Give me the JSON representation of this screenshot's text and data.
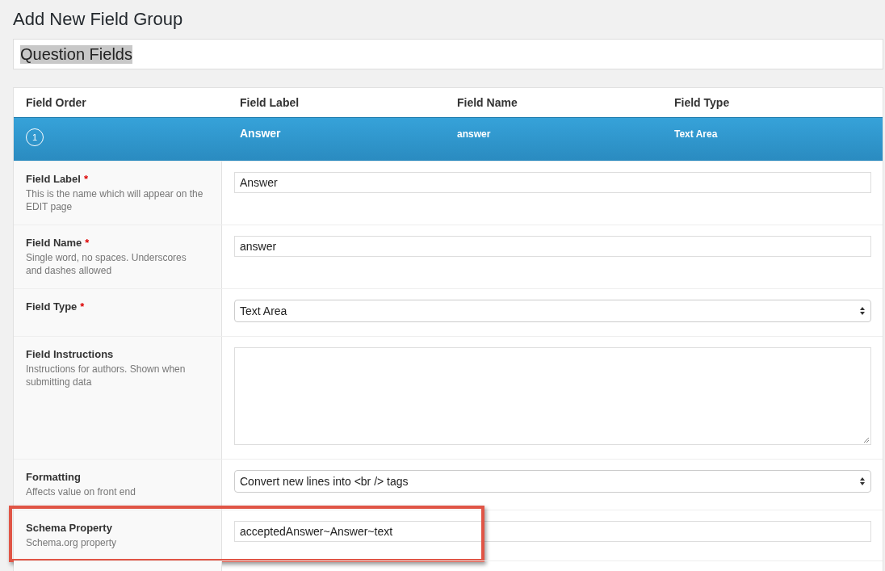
{
  "page_title": "Add New Field Group",
  "title_field": {
    "value": "Question Fields",
    "text_selected": true
  },
  "table": {
    "columns": [
      "Field Order",
      "Field Label",
      "Field Name",
      "Field Type"
    ],
    "rows": [
      {
        "order": "1",
        "label": "Answer",
        "name": "answer",
        "type": "Text Area",
        "selected": true
      }
    ]
  },
  "settings": [
    {
      "label": "Field Label",
      "required_mark": "*",
      "description": "This is the name which will appear on the EDIT page",
      "kind": "text",
      "value": "Answer",
      "highlighted": false
    },
    {
      "label": "Field Name",
      "required_mark": "*",
      "description": "Single word, no spaces. Underscores and dashes allowed",
      "kind": "text",
      "value": "answer",
      "highlighted": false
    },
    {
      "label": "Field Type",
      "required_mark": "*",
      "kind": "select",
      "value": "Text Area",
      "highlighted": false
    },
    {
      "label": "Field Instructions",
      "description": "Instructions for authors. Shown when submitting data",
      "kind": "textarea",
      "highlighted": false
    },
    {
      "label": "Formatting",
      "description": "Affects value on front end",
      "kind": "select",
      "value": "Convert new lines into <br /> tags",
      "highlighted": false
    },
    {
      "label": "Schema Property",
      "description": "Schema.org property",
      "kind": "text",
      "value": "acceptedAnswer~Answer~text",
      "highlighted": true
    }
  ]
}
